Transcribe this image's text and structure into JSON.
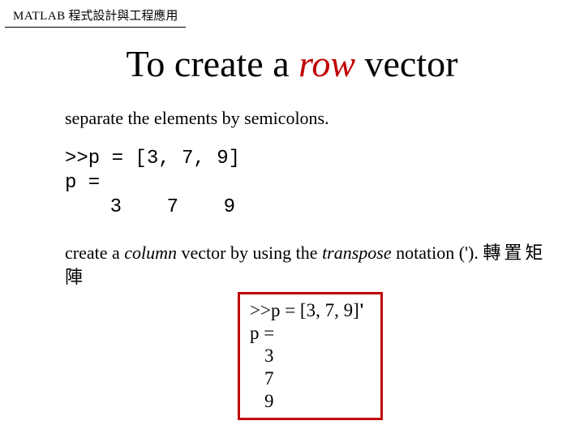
{
  "header": {
    "matlab": "MATLAB",
    "rest": " 程式設計與工程應用"
  },
  "title": {
    "pre": "To create a ",
    "row": "row",
    "post": " vector"
  },
  "subtitle": "separate the elements by semicolons.",
  "code": {
    "line1": ">>p = [3, 7, 9]",
    "line2": "p =",
    "vals": [
      "3",
      "7",
      "9"
    ]
  },
  "desc": {
    "t1": "create a ",
    "col": "column",
    "t2": " vector by using the ",
    "trans": "transpose",
    "t3": " notation (').  ",
    "cjk": "轉置矩陣"
  },
  "redbox": {
    "line1a": ">>p = [3, 7, 9]",
    "prime": "'",
    "line2": "p =",
    "v1": "3",
    "v2": "7",
    "v3": "9"
  }
}
